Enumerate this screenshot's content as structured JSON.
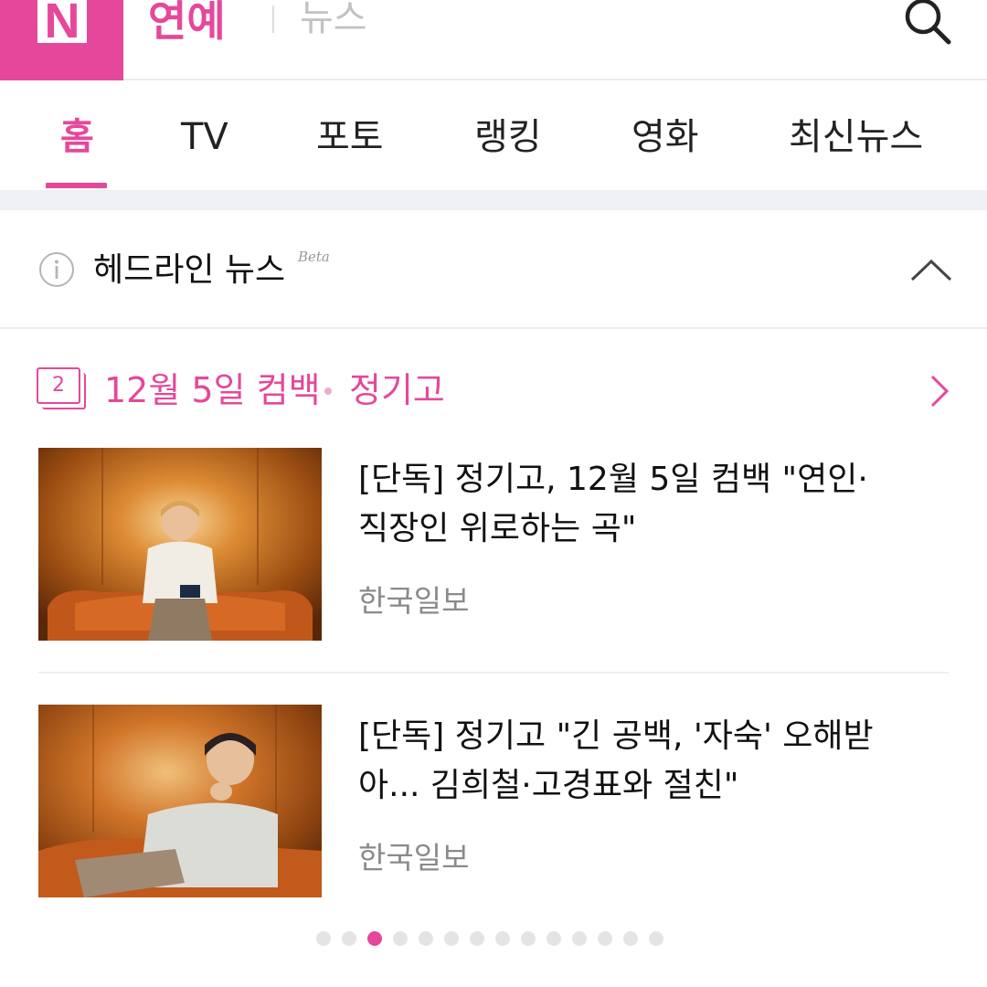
{
  "header": {
    "logo": "N",
    "section": "연예",
    "subsection": "뉴스",
    "icons": {
      "search": "search-icon"
    },
    "colors": {
      "brand": "#e5489a",
      "divider": "#ececec"
    }
  },
  "tabs": [
    {
      "label": "홈",
      "active": true
    },
    {
      "label": "TV",
      "active": false
    },
    {
      "label": "포토",
      "active": false
    },
    {
      "label": "랭킹",
      "active": false
    },
    {
      "label": "영화",
      "active": false
    },
    {
      "label": "최신뉴스",
      "active": false
    }
  ],
  "headline": {
    "title": "헤드라인 뉴스",
    "badge": "Beta",
    "icons": {
      "info": "info-icon",
      "collapse": "chevron-up-icon"
    }
  },
  "cluster": {
    "index": "2",
    "title": "12월 5일 컴백",
    "subtitle": "정기고",
    "icons": {
      "more": "chevron-right-icon"
    }
  },
  "articles": [
    {
      "title_lines": [
        "[단독] 정기고, 12월 5일 컴백 \"연인·",
        "직장인 위로하는 곡\""
      ],
      "source": "한국일보",
      "thumbnail": "photo-man-seated-orange-sofa"
    },
    {
      "title_lines": [
        "[단독] 정기고 \"긴 공백, '자숙' 오해받",
        "아... 김희철·고경표와 절친\""
      ],
      "source": "한국일보",
      "thumbnail": "photo-man-reclining-orange-sofa"
    }
  ],
  "pagination": {
    "total": 14,
    "current": 3
  }
}
